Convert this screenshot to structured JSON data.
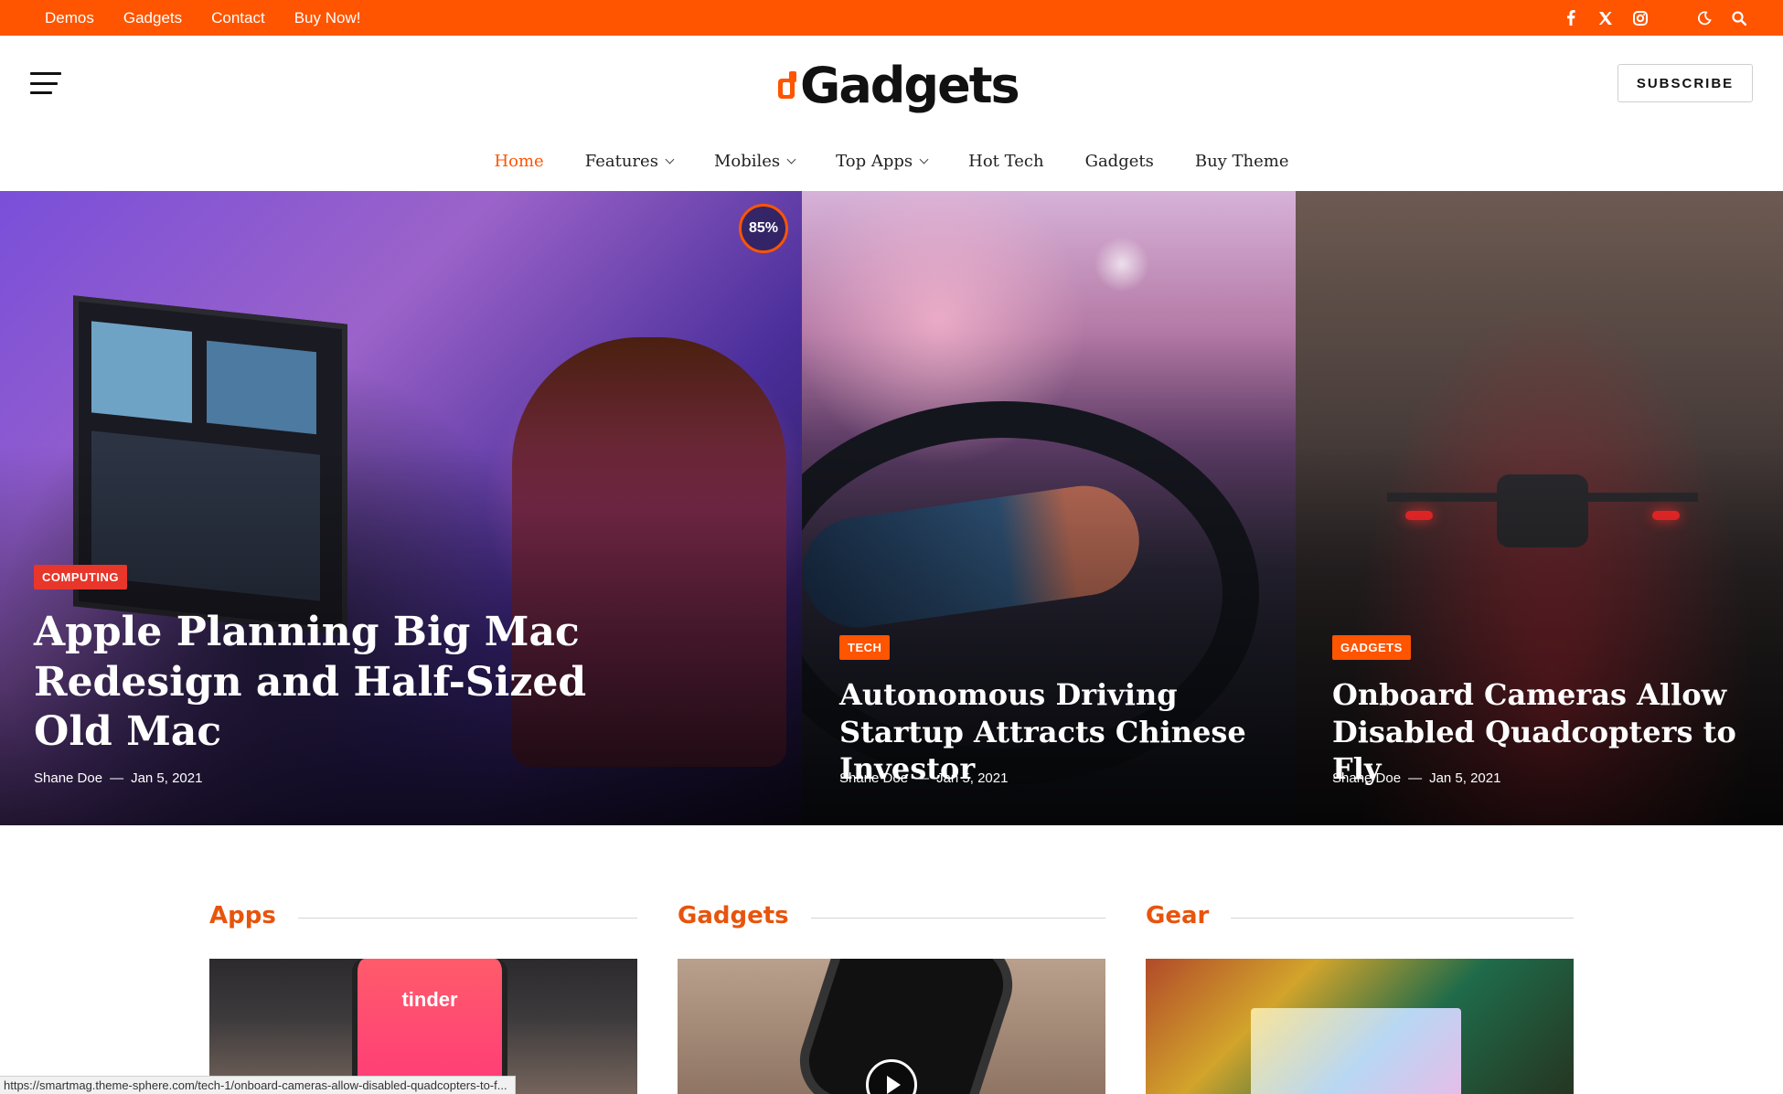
{
  "topbar": {
    "links": [
      "Demos",
      "Gadgets",
      "Contact",
      "Buy Now!"
    ],
    "icons": [
      "facebook-icon",
      "x-twitter-icon",
      "instagram-icon",
      "dark-mode-moon-icon",
      "search-icon"
    ],
    "color": "#ff5400"
  },
  "header": {
    "logo_text": "Gadgets",
    "subscribe_label": "SUBSCRIBE"
  },
  "nav": {
    "items": [
      {
        "label": "Home",
        "active": true
      },
      {
        "label": "Features",
        "dropdown": true
      },
      {
        "label": "Mobiles",
        "dropdown": true
      },
      {
        "label": "Top Apps",
        "dropdown": true
      },
      {
        "label": "Hot Tech"
      },
      {
        "label": "Gadgets"
      },
      {
        "label": "Buy Theme"
      }
    ]
  },
  "hero": {
    "cards": [
      {
        "category": "COMPUTING",
        "title": "Apple Planning Big Mac Redesign and Half-Sized Old Mac",
        "author": "Shane Doe",
        "date": "Jan 5, 2021",
        "score": "85%"
      },
      {
        "category": "TECH",
        "title": "Autonomous Driving Startup Attracts Chinese Investor",
        "author": "Shane Doe",
        "date": "Jan 5, 2021"
      },
      {
        "category": "GADGETS",
        "title": "Onboard Cameras Allow Disabled Quadcopters to Fly",
        "author": "Shane Doe",
        "date": "Jan 5, 2021"
      }
    ]
  },
  "sections": [
    {
      "title": "Apps",
      "image_text": "tinder"
    },
    {
      "title": "Gadgets"
    },
    {
      "title": "Gear"
    }
  ],
  "status_url": "https://smartmag.theme-sphere.com/tech-1/onboard-cameras-allow-disabled-quadcopters-to-f...",
  "meta_sep": "—"
}
